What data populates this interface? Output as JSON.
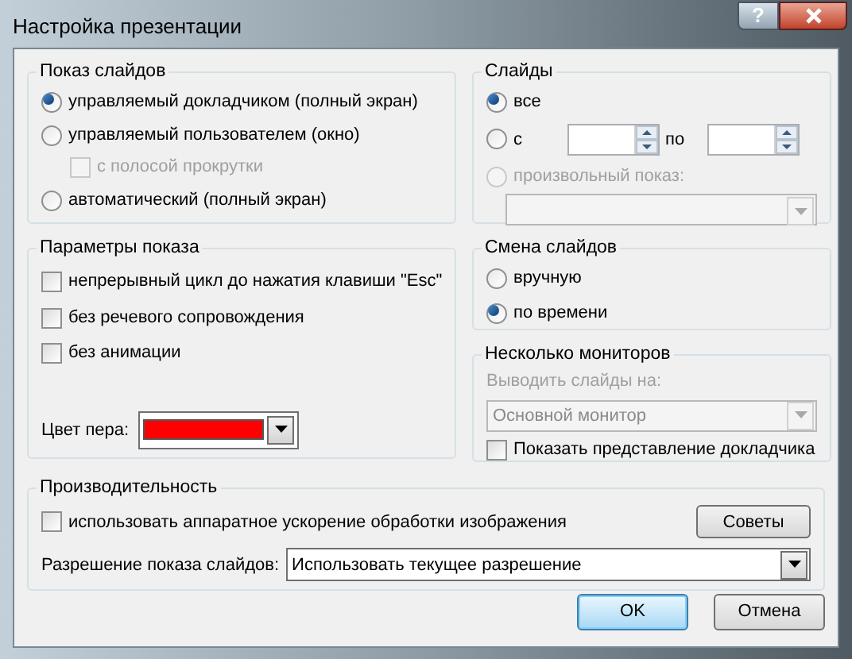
{
  "window": {
    "title": "Настройка презентации",
    "help": "?"
  },
  "show_type": {
    "title": "Показ слайдов",
    "options": [
      {
        "kind": "radio",
        "label": "управляемый докладчиком (полный экран)",
        "selected": true,
        "disabled": false
      },
      {
        "kind": "radio",
        "label": "управляемый пользователем (окно)",
        "selected": false,
        "disabled": false
      },
      {
        "kind": "checkbox",
        "label": "с полосой прокрутки",
        "checked": false,
        "disabled": true
      },
      {
        "kind": "radio",
        "label": "автоматический (полный экран)",
        "selected": false,
        "disabled": false
      }
    ]
  },
  "slides": {
    "title": "Слайды",
    "options": [
      {
        "kind": "radio",
        "label": "все",
        "selected": true,
        "disabled": false
      },
      {
        "kind": "range",
        "label": "с",
        "to_label": "по",
        "selected": false
      },
      {
        "kind": "radio",
        "label": "произвольный показ:",
        "selected": false,
        "disabled": true
      }
    ],
    "custom_show": {
      "disabled": true
    }
  },
  "show_options": {
    "title": "Параметры показа",
    "checkboxes": [
      {
        "label": "непрерывный цикл до нажатия клавиши \"Esc\"",
        "checked": false
      },
      {
        "label": "без речевого сопровождения",
        "checked": false
      },
      {
        "label": "без анимации",
        "checked": false
      }
    ],
    "pen_color": {
      "label": "Цвет пера:",
      "color": "#ff0000"
    }
  },
  "advance": {
    "title": "Смена слайдов",
    "options": [
      {
        "label": "вручную",
        "selected": false
      },
      {
        "label": "по времени",
        "selected": true
      }
    ]
  },
  "monitors": {
    "title": "Несколько мониторов",
    "label": "Выводить слайды на:",
    "value": "Основной монитор",
    "disabled": true,
    "presenter_view": {
      "label": "Показать представление докладчика",
      "checked": false
    }
  },
  "performance": {
    "title": "Производительность",
    "hw_accel": {
      "label": "использовать аппаратное ускорение обработки изображения",
      "checked": false
    },
    "tips": "Советы",
    "resolution": {
      "label": "Разрешение показа слайдов:",
      "value": "Использовать текущее разрешение"
    }
  },
  "buttons": [
    {
      "label": "OK",
      "default": true
    },
    {
      "label": "Отмена",
      "default": false
    }
  ]
}
